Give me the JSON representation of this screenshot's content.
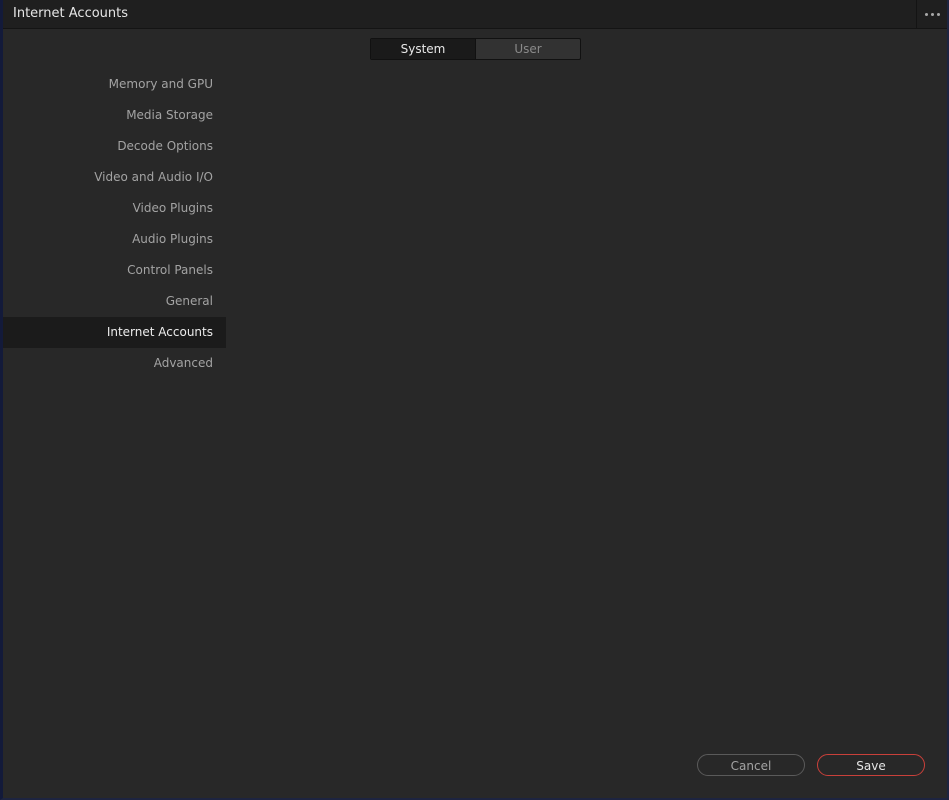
{
  "window": {
    "title": "Internet Accounts",
    "menu_icon": "more-horizontal-icon"
  },
  "scope_toggle": {
    "options": [
      {
        "label": "System",
        "selected": true
      },
      {
        "label": "User",
        "selected": false
      }
    ]
  },
  "sidebar": {
    "items": [
      {
        "label": "Memory and GPU",
        "selected": false
      },
      {
        "label": "Media Storage",
        "selected": false
      },
      {
        "label": "Decode Options",
        "selected": false
      },
      {
        "label": "Video and Audio I/O",
        "selected": false
      },
      {
        "label": "Video Plugins",
        "selected": false
      },
      {
        "label": "Audio Plugins",
        "selected": false
      },
      {
        "label": "Control Panels",
        "selected": false
      },
      {
        "label": "General",
        "selected": false
      },
      {
        "label": "Internet Accounts",
        "selected": true
      },
      {
        "label": "Advanced",
        "selected": false
      }
    ]
  },
  "footer": {
    "cancel_label": "Cancel",
    "save_label": "Save"
  },
  "colors": {
    "background": "#282828",
    "titlebar": "#1f1f1f",
    "selected_item_bg": "#1b1b1b",
    "save_border": "#c9403a"
  }
}
